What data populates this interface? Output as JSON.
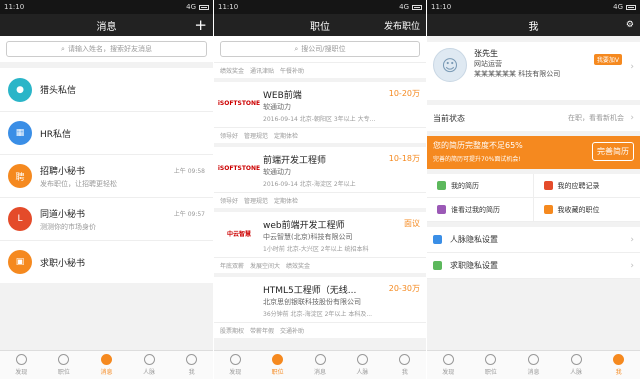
{
  "status": {
    "time": "11:10",
    "net": "4G"
  },
  "s1": {
    "title": "消息",
    "search": "请输入姓名，搜索好友消息",
    "items": [
      {
        "title": "猎头私信",
        "sub": "",
        "time": "",
        "icon": "person-icon",
        "color": "#2ab5c8",
        "glyph": "●"
      },
      {
        "title": "HR私信",
        "sub": "",
        "time": "",
        "icon": "building-icon",
        "color": "#3a8ee6",
        "glyph": "▦"
      },
      {
        "title": "招聘小秘书",
        "sub": "发布职位，让招聘更轻松",
        "time": "上午 09:58",
        "icon": "recruit-icon",
        "color": "#f5891f",
        "glyph": "聘"
      },
      {
        "title": "同道小秘书",
        "sub": "测测你的市场身价",
        "time": "上午 09:57",
        "icon": "tongdao-icon",
        "color": "#e44b2a",
        "glyph": "L"
      },
      {
        "title": "求职小秘书",
        "sub": "",
        "time": "",
        "icon": "briefcase-icon",
        "color": "#f5891f",
        "glyph": "▣"
      }
    ]
  },
  "s2": {
    "title": "职位",
    "publish": "发布职位",
    "search": "搜公司/搜职位",
    "toptags": [
      "绩效奖金",
      "通讯津贴",
      "午餐补助"
    ],
    "jobs": [
      {
        "title": "WEB前端",
        "company": "软通动力",
        "meta": "2016-09-14  北京-朝阳区  3年以上  大专...",
        "salary": "10-20万",
        "logo": "iSOFTSTONE",
        "tags": [
          "领导好",
          "管理规范",
          "定期体检"
        ]
      },
      {
        "title": "前端开发工程师",
        "company": "软通动力",
        "meta": "2016-09-14  北京-海淀区  2年以上",
        "salary": "10-18万",
        "logo": "iSOFTSTONE",
        "tags": [
          "领导好",
          "管理规范",
          "定期体检"
        ]
      },
      {
        "title": "web前端开发工程师",
        "company": "中云智慧(北京)科技有限公司",
        "meta": "1小时前  北京-大兴区  2年以上  统招本科",
        "salary": "面议",
        "logo": "中云智慧",
        "tags": [
          "年底双薪",
          "发展空间大",
          "绩效奖金"
        ]
      },
      {
        "title": "HTML5工程师（无线...",
        "company": "北京思创银联科技股份有限公司",
        "meta": "36分钟前  北京-海淀区  2年以上  本科及...",
        "salary": "20-30万",
        "logo": "",
        "tags": [
          "股票期权",
          "带薪年假",
          "交通补助"
        ]
      }
    ]
  },
  "s3": {
    "title": "我",
    "name": "张先生",
    "role": "网站运营",
    "company": "某某某某某某 科技有限公司",
    "vip": "我要加V",
    "state_label": "当前状态",
    "state_value": "在职，看看新机会",
    "banner_title": "您的简历完整度不足65%",
    "banner_sub": "完善的简历可提升70%面试机会!",
    "banner_btn": "完善简历",
    "grid": [
      {
        "label": "我的简历",
        "color": "#5cb85c"
      },
      {
        "label": "我的应聘记录",
        "color": "#e44b2a"
      },
      {
        "label": "谁看过我的简历",
        "color": "#9b59b6"
      },
      {
        "label": "我收藏的职位",
        "color": "#f5891f"
      }
    ],
    "rows": [
      {
        "label": "人脉隐私设置",
        "color": "#3a8ee6"
      },
      {
        "label": "求职隐私设置",
        "color": "#5cb85c"
      }
    ]
  },
  "tabs": [
    "发现",
    "职位",
    "消息",
    "人脉",
    "我"
  ]
}
